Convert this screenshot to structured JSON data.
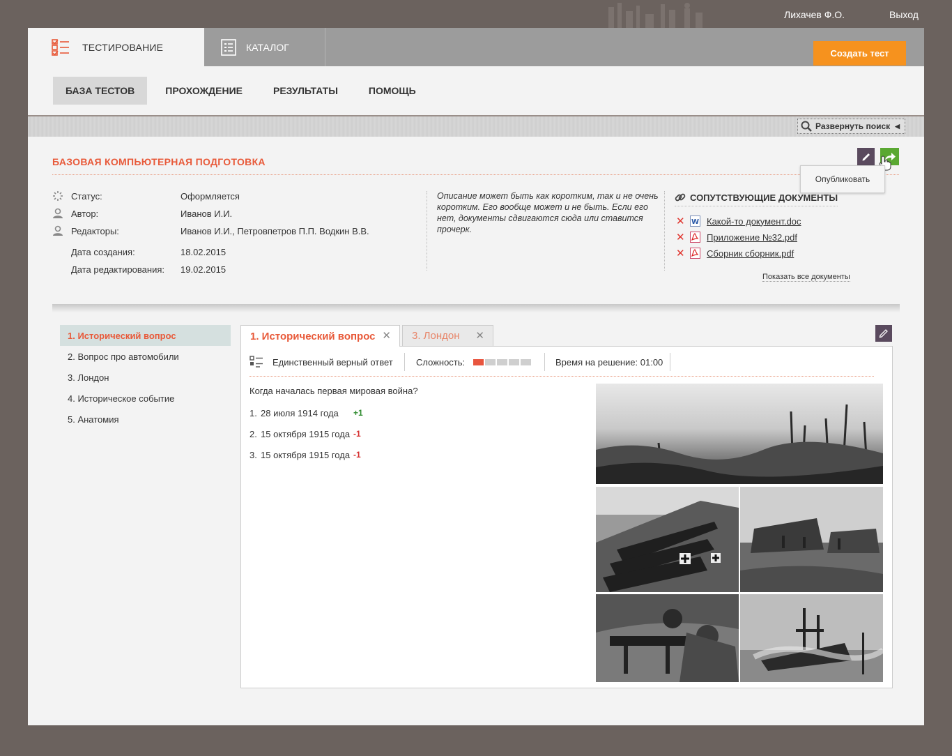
{
  "top": {
    "user": "Лихачев Ф.О.",
    "logout": "Выход"
  },
  "header": {
    "tabs": [
      {
        "label": "ТЕСТИРОВАНИЕ"
      },
      {
        "label": "КАТАЛОГ"
      }
    ],
    "create_button": "Создать тест"
  },
  "subnav": [
    {
      "label": "БАЗА ТЕСТОВ"
    },
    {
      "label": "ПРОХОЖДЕНИЕ"
    },
    {
      "label": "РЕЗУЛЬТАТЫ"
    },
    {
      "label": "ПОМОЩЬ"
    }
  ],
  "search": {
    "expand_label": "Развернуть поиск"
  },
  "test": {
    "title": "БАЗОВАЯ КОМПЬЮТЕРНАЯ ПОДГОТОВКА",
    "publish_tooltip": "Опубликовать",
    "fields": [
      {
        "key": "Статус:",
        "value": "Оформляется",
        "icon": "spinner-icon"
      },
      {
        "key": "Автор:",
        "value": "Иванов И.И.",
        "icon": "user-icon"
      },
      {
        "key": "Редакторы:",
        "value": "Иванов И.И., Петровпетров П.П. Водкин В.В.",
        "icon": "user-icon"
      },
      {
        "key": "Дата создания:",
        "value": "18.02.2015"
      },
      {
        "key": "Дата редактирования:",
        "value": "19.02.2015"
      }
    ],
    "description": "Описание может быть как коротким, так и не очень коротким. Его вообще может и не быть. Если его нет, документы сдвигаются сюда или ставится прочерк."
  },
  "documents": {
    "title": "СОПУТСТВУЮЩИЕ ДОКУМЕНТЫ",
    "items": [
      {
        "name": "Какой-то документ.doc",
        "type": "doc"
      },
      {
        "name": "Приложение №32.pdf",
        "type": "pdf"
      },
      {
        "name": "Сборник сборник.pdf",
        "type": "pdf"
      }
    ],
    "remove_symbol": "✕",
    "show_all": "Показать все документы"
  },
  "questions": [
    {
      "label": "1. Исторический вопрос"
    },
    {
      "label": "2. Вопрос про автомобили"
    },
    {
      "label": "3. Лондон"
    },
    {
      "label": "4. Историческое событие"
    },
    {
      "label": "5. Анатомия"
    }
  ],
  "open_tabs": [
    {
      "label": "1. Исторический вопрос"
    },
    {
      "label": "3. Лондон"
    }
  ],
  "close_symbol": "✕",
  "question_detail": {
    "answer_type": "Единственный верный ответ",
    "difficulty_label": "Сложность:",
    "difficulty_level": 1,
    "difficulty_max": 5,
    "time_label": "Время на решение: 01:00",
    "text": "Когда началась первая мировая война?",
    "answers": [
      {
        "num": "1.",
        "text": "28 июля 1914 года",
        "score": "+1"
      },
      {
        "num": "2.",
        "text": "15 октября 1915 года",
        "score": "-1"
      },
      {
        "num": "3.",
        "text": "15 октября 1915 года",
        "score": "-1"
      }
    ]
  },
  "colors": {
    "accent": "#e85a3a",
    "orange_button": "#f6921e",
    "publish_green": "#5aa832",
    "edit_purple": "#5a4a5e",
    "page_bg": "#6b625e"
  }
}
